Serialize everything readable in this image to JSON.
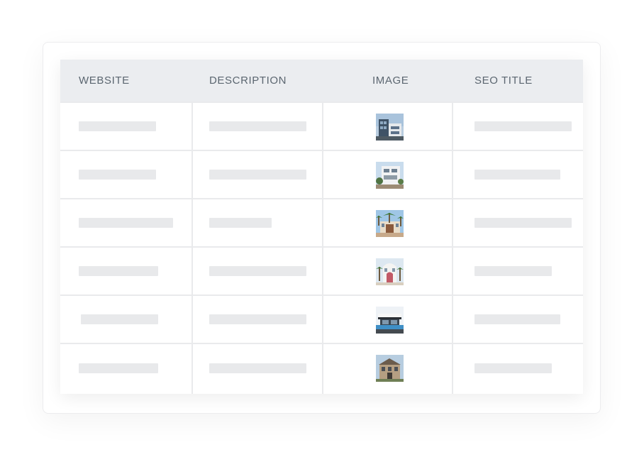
{
  "table": {
    "columns": [
      "WEBSITE",
      "DESCRIPTION",
      "IMAGE",
      "SEO TITLE"
    ],
    "rows": [
      {
        "thumbnail": "modern-tower-house-thumbnail"
      },
      {
        "thumbnail": "white-modern-villa-thumbnail"
      },
      {
        "thumbnail": "palm-tree-mansion-thumbnail"
      },
      {
        "thumbnail": "white-arched-house-thumbnail"
      },
      {
        "thumbnail": "pool-villa-thumbnail"
      },
      {
        "thumbnail": "classic-stone-house-thumbnail"
      }
    ]
  },
  "colors": {
    "header_bg": "#ebedf0",
    "header_text": "#5b6670",
    "placeholder_bar": "#e8e9eb",
    "grid_line": "#e9eaec"
  }
}
